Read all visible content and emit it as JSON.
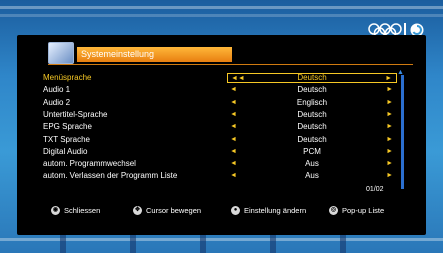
{
  "logo": {
    "text": "ɔ೦ | ◕"
  },
  "header": {
    "title": "Systemeinstellung"
  },
  "settings": [
    {
      "label": "Menüsprache",
      "value": "Deutsch",
      "active": true
    },
    {
      "label": "Audio 1",
      "value": "Deutsch"
    },
    {
      "label": "Audio 2",
      "value": "Englisch"
    },
    {
      "label": "Untertitel-Sprache",
      "value": "Deutsch"
    },
    {
      "label": "EPG Sprache",
      "value": "Deutsch"
    },
    {
      "label": "TXT Sprache",
      "value": "Deutsch"
    },
    {
      "label": "Digital Audio",
      "value": "PCM"
    },
    {
      "label": "autom. Programmwechsel",
      "value": "Aus"
    },
    {
      "label": "autom. Verlassen der Programm Liste",
      "value": "Aus"
    }
  ],
  "page_indicator": "01/02",
  "footer": [
    {
      "icon": "exit-icon",
      "label": "Schliessen"
    },
    {
      "icon": "cursor-icon",
      "label": "Cursor bewegen"
    },
    {
      "icon": "ok-icon",
      "label": "Einstellung ändern"
    },
    {
      "icon": "popup-icon",
      "label": "Pop-up Liste"
    }
  ]
}
